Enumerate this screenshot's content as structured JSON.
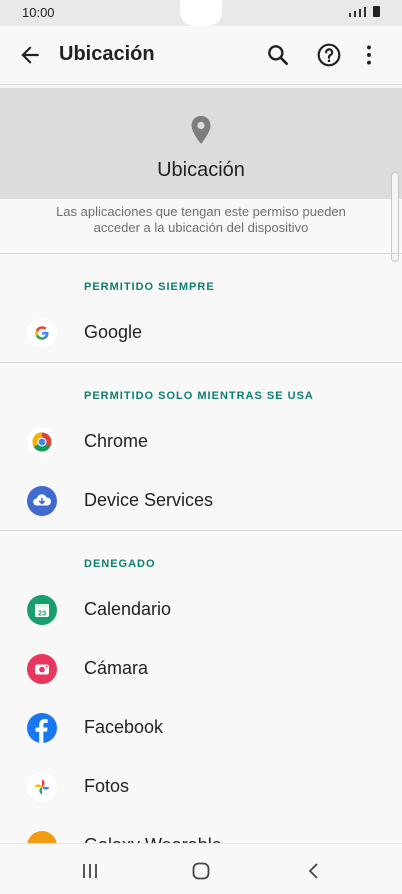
{
  "status_bar": {
    "time": "10:00"
  },
  "app_bar": {
    "title": "Ubicación"
  },
  "header": {
    "title": "Ubicación",
    "description": "Las aplicaciones que tengan este permiso pueden acceder a la ubicación del dispositivo"
  },
  "sections": [
    {
      "label": "PERMITIDO SIEMPRE",
      "apps": [
        "Google"
      ]
    },
    {
      "label": "PERMITIDO SOLO MIENTRAS SE USA",
      "apps": [
        "Chrome",
        "Device Services"
      ]
    },
    {
      "label": "DENEGADO",
      "apps": [
        "Calendario",
        "Cámara",
        "Facebook",
        "Fotos",
        "Galaxy Wearable"
      ]
    }
  ],
  "icons": {
    "back": "arrow-back-icon",
    "search": "search-icon",
    "help": "help-icon",
    "more": "more-vert-icon",
    "location": "location-pin-icon"
  },
  "colors": {
    "accent": "#0d7f6e",
    "header_bg": "#dcdcdc"
  }
}
